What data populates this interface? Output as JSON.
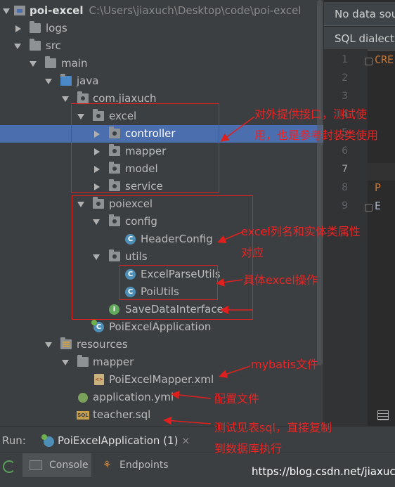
{
  "tree": {
    "root_name": "poi-excel",
    "root_path": "C:\\Users\\jiaxuch\\Desktop\\code\\poi-excel",
    "items": [
      {
        "label": "logs"
      },
      {
        "label": "src"
      },
      {
        "label": "main"
      },
      {
        "label": "java"
      },
      {
        "label": "com.jiaxuch"
      },
      {
        "label": "excel"
      },
      {
        "label": "controller"
      },
      {
        "label": "mapper"
      },
      {
        "label": "model"
      },
      {
        "label": "service"
      },
      {
        "label": "poiexcel"
      },
      {
        "label": "config"
      },
      {
        "label": "HeaderConfig"
      },
      {
        "label": "utils"
      },
      {
        "label": "ExcelParseUtils"
      },
      {
        "label": "PoiUtils"
      },
      {
        "label": "SaveDataInterface"
      },
      {
        "label": "PoiExcelApplication"
      },
      {
        "label": "resources"
      },
      {
        "label": "mapper"
      },
      {
        "label": "PoiExcelMapper.xml"
      },
      {
        "label": "application.yml"
      },
      {
        "label": "teacher.sql"
      }
    ],
    "icon_text": {
      "class": "C",
      "interface": "I",
      "xml": "<>",
      "sql": "SQL"
    }
  },
  "editor": {
    "banner_datasource": "No data sou",
    "banner_dialect": "SQL dialect",
    "line_numbers": [
      "1",
      "2",
      "3",
      "4",
      "5",
      "6",
      "7",
      "8",
      "9"
    ],
    "code": {
      "line1": "CRE",
      "line8": "P",
      "line9": "E"
    }
  },
  "run": {
    "label": "Run:",
    "config": "PoiExcelApplication (1)",
    "close": "×",
    "tabs": {
      "console": "Console",
      "endpoints": "Endpoints"
    }
  },
  "annotations": {
    "excel": "对外提供接口，测试使用，也是参考封装类使用",
    "header": "excel列名和实体类属性对应",
    "utils": "具体excel操作",
    "mybatis": "mybatis文件",
    "config": "配置文件",
    "sql": "测试见表sql，直接复制到数据库执行"
  },
  "watermark": "https://blog.csdn.net/jiaxuch",
  "colors": {
    "selection": "#4b6eaf",
    "annotation": "#e0201e",
    "panel": "#3c3f41",
    "editor": "#2b2b2b"
  }
}
